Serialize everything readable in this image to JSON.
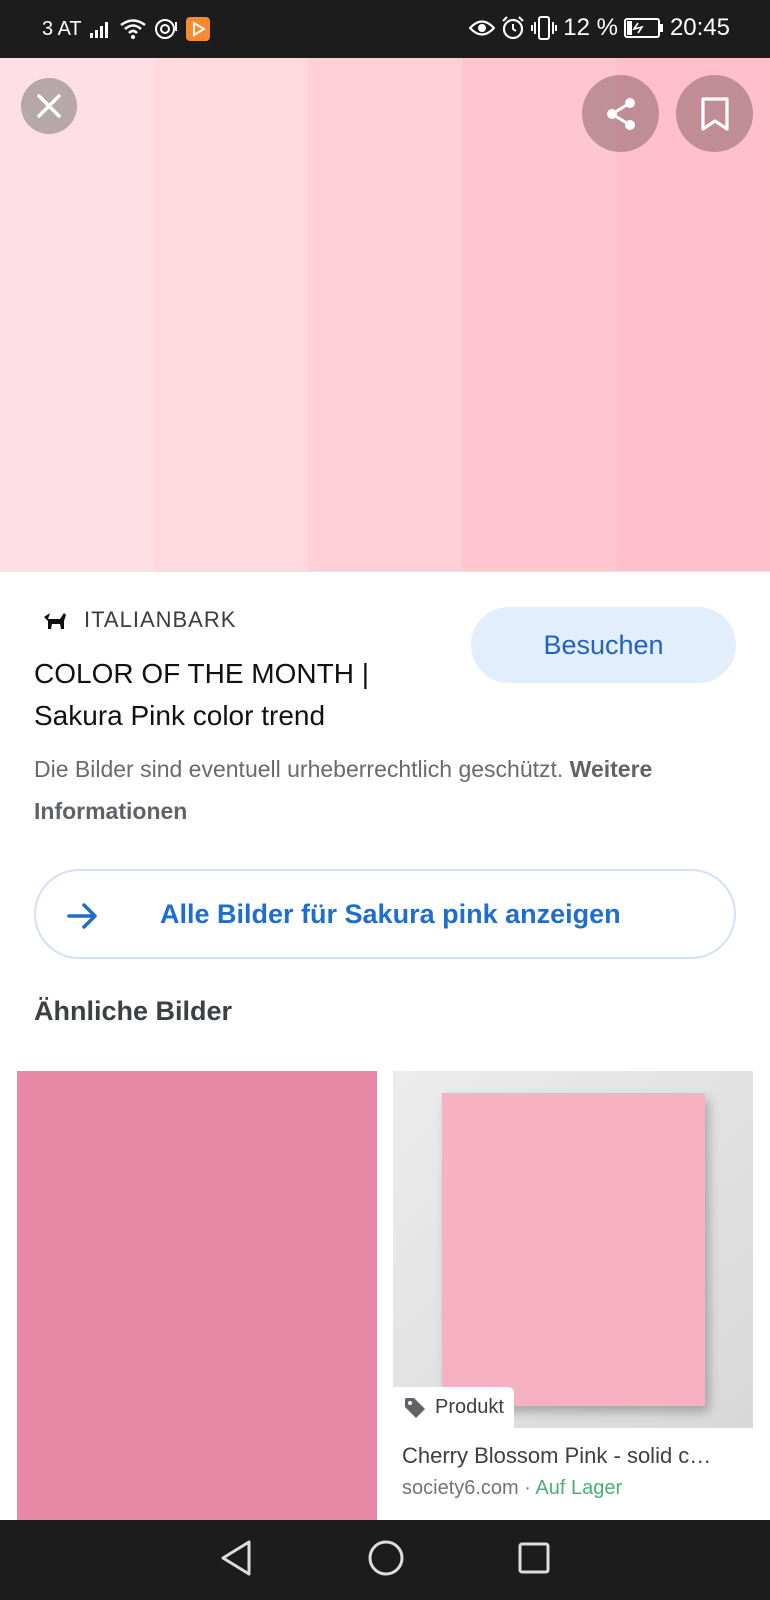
{
  "status_bar": {
    "carrier": "3 AT",
    "battery_percent": "12 %",
    "time": "20:45",
    "icons": [
      "signal-icon",
      "wifi-icon",
      "hotspot-icon",
      "play-app-icon",
      "eye-icon",
      "alarm-icon",
      "vibrate-icon",
      "battery-icon"
    ]
  },
  "hero": {
    "stripe_colors": [
      "#ffdfe6",
      "#ffd8e0",
      "#ffcfd9",
      "#ffc6d2",
      "#ffbfcc"
    ]
  },
  "source": {
    "name": "ITALIANBARK",
    "visit_label": "Besuchen",
    "title": "COLOR OF THE MONTH | Sakura Pink color trend"
  },
  "copyright": {
    "text": "Die Bilder sind eventuell urheberrechtlich geschützt.",
    "link": "Weitere Informationen"
  },
  "all_images": {
    "label": "Alle Bilder für Sakura pink anzeigen"
  },
  "similar": {
    "heading": "Ähnliche Bilder",
    "cards": [
      {
        "color": "#e889a7"
      },
      {
        "badge": "Produkt",
        "title": "Cherry Blossom Pink - solid c…",
        "site": "society6.com",
        "separator": " · ",
        "stock": "Auf Lager",
        "color": "#f6b2c3"
      }
    ]
  },
  "colors": {
    "accent_blue": "#1f6ecd",
    "visit_bg": "#e3eefd",
    "bar_bg": "#1c1c1c"
  }
}
